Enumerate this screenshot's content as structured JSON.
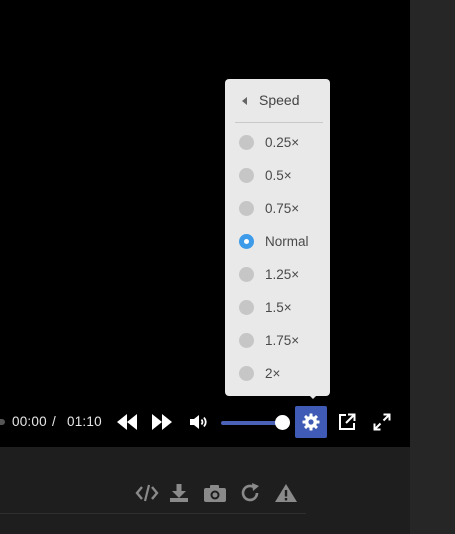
{
  "player": {
    "time_current": "00:00",
    "time_separator": "/",
    "time_total": "01:10",
    "volume_level": 0.95,
    "accent_color": "#3f5bb5",
    "controls": {
      "rewind_icon": "rewind-icon",
      "fast_forward_icon": "fast-forward-icon",
      "volume_icon": "volume-icon",
      "settings_icon": "gear-icon",
      "popout_icon": "external-link-icon",
      "fullscreen_icon": "fullscreen-icon"
    }
  },
  "speed_menu": {
    "title": "Speed",
    "selected": "Normal",
    "options": [
      {
        "label": "0.25×",
        "selected": false
      },
      {
        "label": "0.5×",
        "selected": false
      },
      {
        "label": "0.75×",
        "selected": false
      },
      {
        "label": "Normal",
        "selected": true
      },
      {
        "label": "1.25×",
        "selected": false
      },
      {
        "label": "1.5×",
        "selected": false
      },
      {
        "label": "1.75×",
        "selected": false
      },
      {
        "label": "2×",
        "selected": false
      }
    ],
    "selected_color": "#3d9be9"
  },
  "actions": {
    "icons": [
      "embed-code-icon",
      "download-icon",
      "camera-icon",
      "refresh-icon",
      "warning-icon"
    ]
  }
}
